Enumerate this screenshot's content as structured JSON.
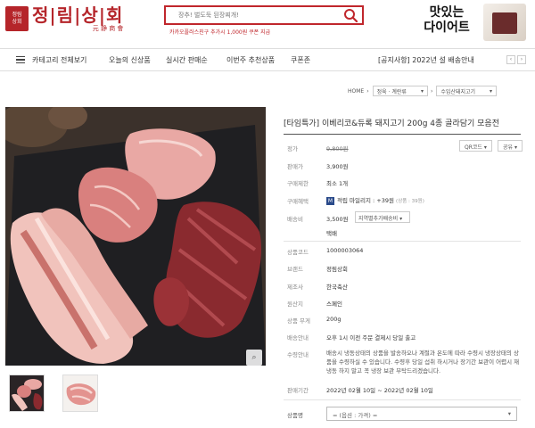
{
  "header": {
    "logo_seal": "정림\n상회",
    "logo_main": "정|림|상|회",
    "logo_sub": "元 静 商 會",
    "search_placeholder": "장추! 벌도둑 된장찌개!",
    "search_hint": "카카오플러스친구 추가시 1,000원 쿠폰 지급",
    "banner_text": "맛있는\n다이어트"
  },
  "nav": {
    "category_label": "카테고리 전체보기",
    "items": [
      "오늘의 신상품",
      "실시간 판매순",
      "이번주 추천상품",
      "쿠폰존"
    ],
    "notice": "[공지사항] 2022년 설 배송안내",
    "prev": "‹",
    "next": "›"
  },
  "breadcrumb": {
    "home": "HOME",
    "level1": "정육 · 계란류",
    "level2": "수입산돼지고기"
  },
  "product": {
    "title": "[타임특가] 이베리코&듀록 돼지고기 200g 4종 골라담기 모음전",
    "rows": {
      "price_label": "정가",
      "price_value": "9,800원",
      "sale_label": "판매가",
      "sale_value": "3,900원",
      "limit_label": "구매제한",
      "limit_value": "최소 1개",
      "benefit_label": "구매혜택",
      "benefit_value": "적립 마일리지 : +39원",
      "benefit_note": "(상품 : 39원)",
      "shipping_label": "배송비",
      "shipping_value": "3,500원",
      "shipping_select": "지역별추가배송비",
      "shipping_method": "택배",
      "code_label": "상품코드",
      "code_value": "1000003064",
      "brand_label": "브랜드",
      "brand_value": "정림상회",
      "maker_label": "제조사",
      "maker_value": "한국축산",
      "origin_label": "원산지",
      "origin_value": "스페인",
      "weight_label": "상품 무게",
      "weight_value": "200g",
      "delivery_label": "배송안내",
      "delivery_value": "오후 1시 이전 주문 결제시 당일 출고",
      "caution_label": "수령안내",
      "caution_value": "배송시 냉동상태의 상품을 발송하오나 계절과 온도에 따라 수령시 냉장상태의 상품을 수령하실 수 있습니다. 수령후 당일 섭취 하시거나 장기간 보관이 어렵시 재냉동 하지 말고 꼭 냉장 보관 부탁드리겠습니다.",
      "period_label": "판매기간",
      "period_value": "2022년 02월 10일 ~ 2022년 02월 10일"
    },
    "qr_button": "QR코드",
    "share_button": "공유",
    "option_label": "상품명",
    "option_placeholder": "= (옵션 : 가격) ="
  },
  "colors": {
    "brand_red": "#b5252a",
    "search_border": "#c0262c"
  }
}
